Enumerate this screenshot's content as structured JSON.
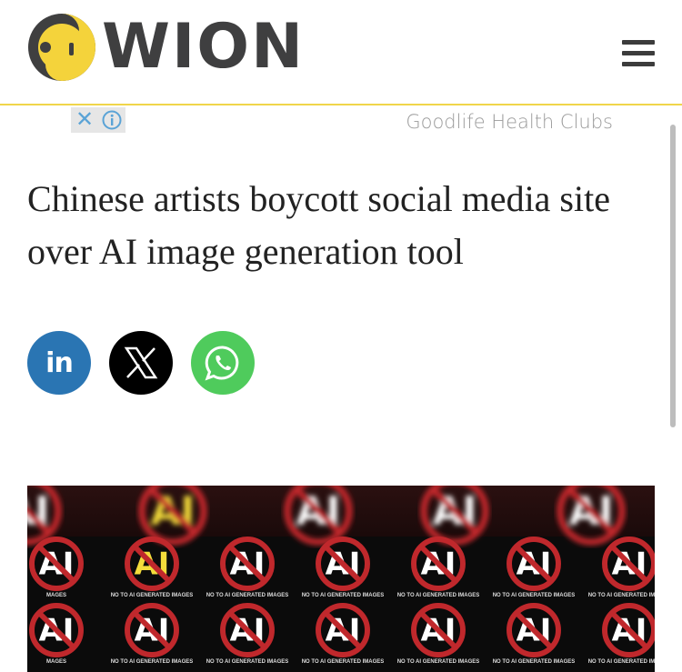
{
  "header": {
    "logo_text": "WION",
    "logo_icon": "wion-logo-icon",
    "menu_icon": "hamburger-menu-icon"
  },
  "ad": {
    "advertiser": "Goodlife Health Clubs",
    "close_icon": "close-icon",
    "info_icon": "info-icon"
  },
  "article": {
    "headline": "Chinese artists boycott social media site over AI image generation tool"
  },
  "share": {
    "buttons": [
      {
        "network": "LinkedIn",
        "label": "in",
        "color": "#2a75b3"
      },
      {
        "network": "X",
        "icon": "x-logo-icon",
        "color": "#000000"
      },
      {
        "network": "WhatsApp",
        "icon": "whatsapp-icon",
        "color": "#4fcb5c"
      }
    ]
  },
  "hero_image": {
    "sign_text": "AI",
    "caption": "NO TO AI GENERATED IMAGES",
    "side_caption": "MAGES",
    "edge_caption": "NO TO A",
    "colors": {
      "sign_red": "#c0282c",
      "sign_yellow": "#f4dc3b",
      "background": "#0b0b0b"
    }
  },
  "colors": {
    "brand_yellow": "#f0d54a",
    "brand_gray": "#3f3f40"
  }
}
